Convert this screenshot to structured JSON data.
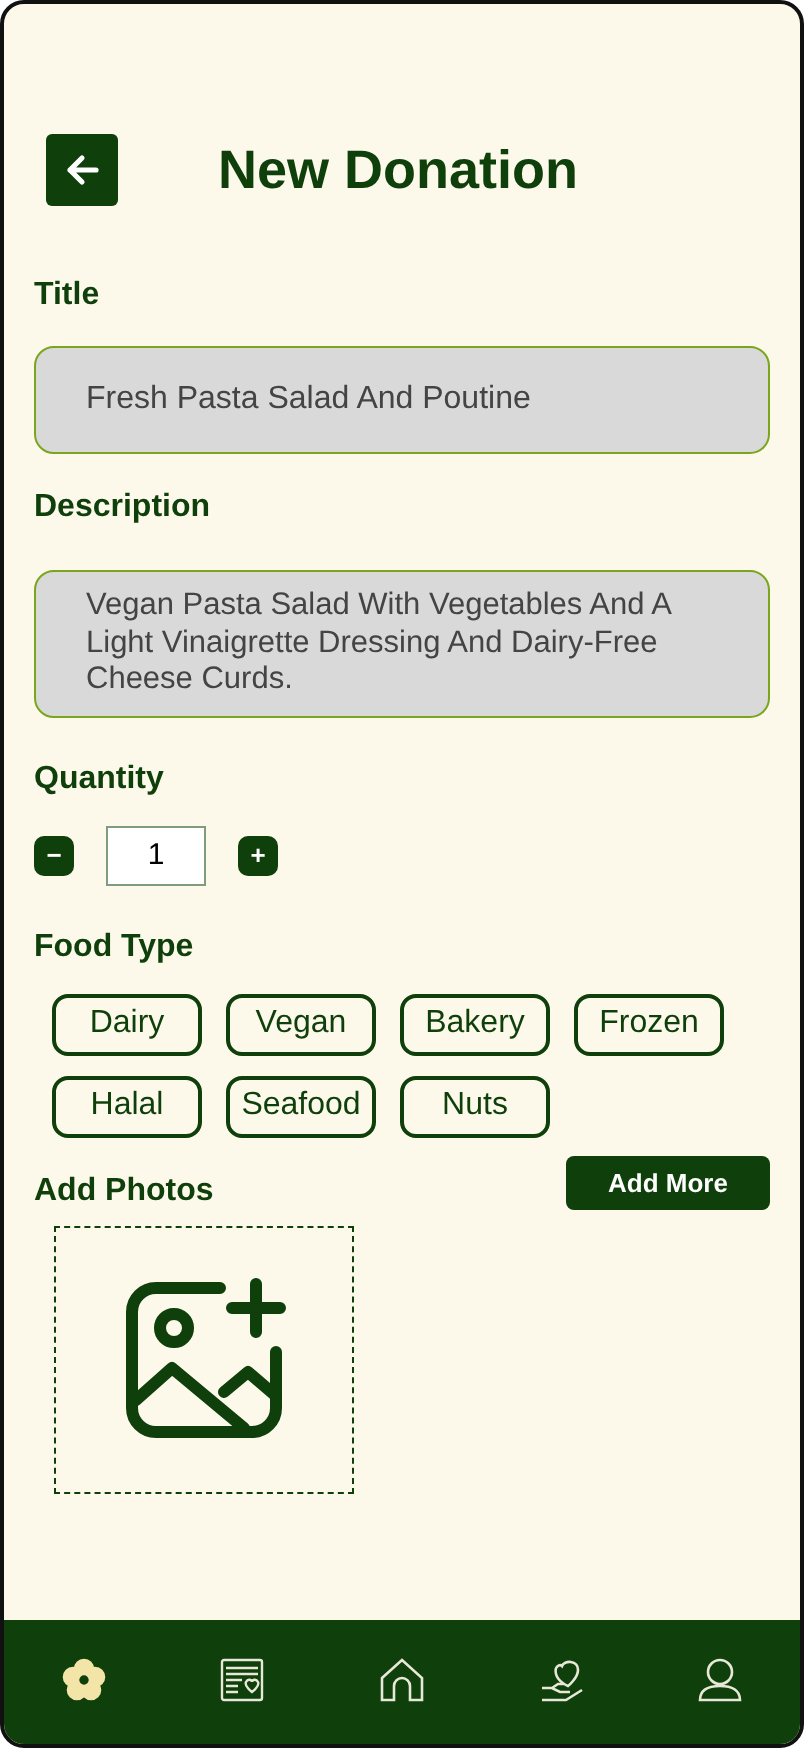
{
  "header": {
    "title": "New Donation"
  },
  "title_field": {
    "label": "Title",
    "value": "Fresh Pasta Salad And Poutine"
  },
  "description_field": {
    "label": "Description",
    "value": "Vegan Pasta Salad With Vegetables And A Light Vinaigrette Dressing And Dairy-Free Cheese Curds."
  },
  "quantity": {
    "label": "Quantity",
    "minus": "−",
    "value": "1",
    "plus": "+"
  },
  "food_type": {
    "label": "Food Type",
    "tags": [
      {
        "label": "Dairy"
      },
      {
        "label": "Vegan"
      },
      {
        "label": "Bakery"
      },
      {
        "label": "Frozen"
      },
      {
        "label": "Halal"
      },
      {
        "label": "Seafood"
      },
      {
        "label": "Nuts"
      }
    ]
  },
  "photos": {
    "label": "Add Photos",
    "button": "Add More"
  },
  "nav": [
    {
      "kind": "flower",
      "selected": true
    },
    {
      "kind": "listing",
      "selected": false
    },
    {
      "kind": "home",
      "selected": false
    },
    {
      "kind": "donate",
      "selected": false
    },
    {
      "kind": "profile",
      "selected": false
    }
  ]
}
